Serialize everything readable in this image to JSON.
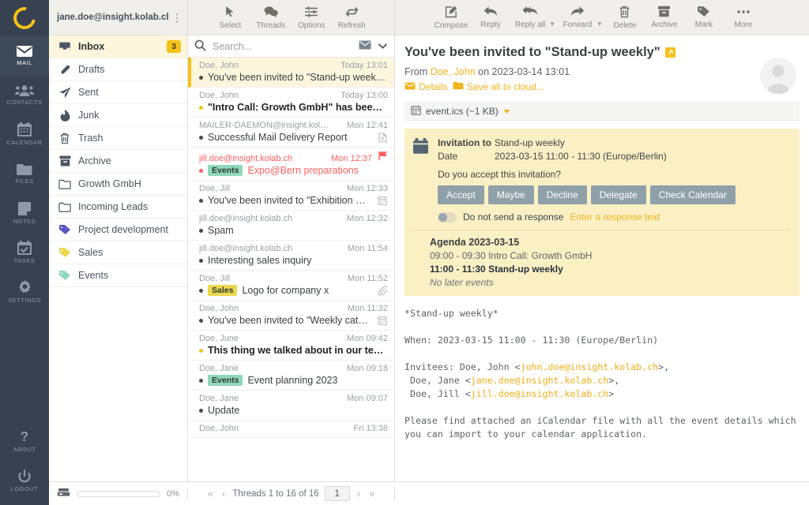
{
  "rail": {
    "logo": "kolab-logo",
    "items": [
      {
        "label": "MAIL",
        "icon": "mail-icon",
        "active": true
      },
      {
        "label": "CONTACTS",
        "icon": "contacts-icon",
        "active": false
      },
      {
        "label": "CALENDAR",
        "icon": "calendar-icon",
        "active": false
      },
      {
        "label": "FILES",
        "icon": "folder-icon",
        "active": false
      },
      {
        "label": "NOTES",
        "icon": "note-icon",
        "active": false
      },
      {
        "label": "TASKS",
        "icon": "tasks-icon",
        "active": false
      },
      {
        "label": "SETTINGS",
        "icon": "gear-icon",
        "active": false
      }
    ],
    "bottom": [
      {
        "label": "ABOUT",
        "icon": "question-icon"
      },
      {
        "label": "LOGOUT",
        "icon": "power-icon"
      }
    ]
  },
  "account": {
    "email": "jane.doe@insight.kolab.ch",
    "menu_icon": "kebab-menu-icon"
  },
  "folders": [
    {
      "label": "Inbox",
      "icon": "inbox-icon",
      "badge": "3",
      "active": true
    },
    {
      "label": "Drafts",
      "icon": "pencil-icon",
      "badge": "",
      "active": false
    },
    {
      "label": "Sent",
      "icon": "paper-plane-icon",
      "badge": "",
      "active": false
    },
    {
      "label": "Junk",
      "icon": "fire-icon",
      "badge": "",
      "active": false
    },
    {
      "label": "Trash",
      "icon": "trash-icon",
      "badge": "",
      "active": false
    },
    {
      "label": "Archive",
      "icon": "archive-icon",
      "badge": "",
      "active": false
    },
    {
      "label": "Growth GmbH",
      "icon": "folder-icon",
      "badge": "",
      "active": false
    },
    {
      "label": "Incoming Leads",
      "icon": "folder-icon",
      "badge": "",
      "active": false
    },
    {
      "label": "Project development",
      "icon": "tag-icon",
      "badge": "",
      "active": false,
      "tag_color": "#5b54c7"
    },
    {
      "label": "Sales",
      "icon": "tag-icon",
      "badge": "",
      "active": false,
      "tag_color": "#ecd84e"
    },
    {
      "label": "Events",
      "icon": "tag-icon",
      "badge": "",
      "active": false,
      "tag_color": "#8fd8bb"
    }
  ],
  "list_toolbar": [
    {
      "label": "Select",
      "icon": "cursor-icon"
    },
    {
      "label": "Threads",
      "icon": "threads-icon"
    },
    {
      "label": "Options",
      "icon": "sliders-icon"
    },
    {
      "label": "Refresh",
      "icon": "refresh-icon"
    }
  ],
  "search": {
    "placeholder": "Search...",
    "icon": "search-icon",
    "scope_icon": "envelope-icon",
    "expand_icon": "chevron-down-icon"
  },
  "messages": [
    {
      "from": "Doe, John",
      "date": "Today 13:01",
      "subject": "You've been invited to \"Stand-up week…",
      "state": "selected",
      "tag": "",
      "icon": ""
    },
    {
      "from": "Doe, John",
      "date": "Today 13:00",
      "subject": "\"Intro Call: Growth GmbH\" has been a…",
      "state": "unread",
      "tag": "",
      "icon": ""
    },
    {
      "from": "MAILER-DAEMON@insight.kol…",
      "date": "Mon 12:41",
      "subject": "Successful Mail Delivery Report",
      "state": "read",
      "tag": "",
      "icon": "document-icon"
    },
    {
      "from": "jill.doe@insight.kolab.ch",
      "date": "Mon 12:37",
      "subject": "Expo@Bern preparations",
      "state": "flagged",
      "tag": "Events",
      "tag_type": "events",
      "icon": "flag-icon"
    },
    {
      "from": "Doe, Jill",
      "date": "Mon 12:33",
      "subject": "You've been invited to \"Exhibition @Be…",
      "state": "read",
      "tag": "",
      "icon": "calendar-icon"
    },
    {
      "from": "jill.doe@insight.kolab.ch",
      "date": "Mon 12:32",
      "subject": "Spam",
      "state": "read",
      "tag": "",
      "icon": ""
    },
    {
      "from": "jill.doe@insight.kolab.ch",
      "date": "Mon 11:54",
      "subject": "Interesting sales inquiry",
      "state": "read",
      "tag": "",
      "icon": ""
    },
    {
      "from": "Doe, Jill",
      "date": "Mon 11:52",
      "subject": "Logo for company x",
      "state": "read",
      "tag": "Sales",
      "tag_type": "sales",
      "icon": "paperclip-icon"
    },
    {
      "from": "Doe, John",
      "date": "Mon 11:32",
      "subject": "You've been invited to \"Weekly catch-…",
      "state": "read",
      "tag": "",
      "icon": "calendar-icon"
    },
    {
      "from": "Doe, June",
      "date": "Mon 09:42",
      "subject": "This thing we talked about in our test…",
      "state": "unread",
      "tag": "",
      "icon": ""
    },
    {
      "from": "Doe, Jane",
      "date": "Mon 09:18",
      "subject": "Event planning 2023",
      "state": "read",
      "tag": "Events",
      "tag_type": "events",
      "icon": ""
    },
    {
      "from": "Doe, Jane",
      "date": "Mon 09:07",
      "subject": "Update",
      "state": "read",
      "tag": "",
      "icon": ""
    },
    {
      "from": "Doe, John",
      "date": "Fri 13:38",
      "subject": "",
      "state": "read",
      "tag": "",
      "icon": ""
    }
  ],
  "preview_toolbar": [
    {
      "label": "Compose",
      "icon": "compose-icon",
      "caret": false
    },
    {
      "label": "Reply",
      "icon": "reply-icon",
      "caret": false
    },
    {
      "label": "Reply all",
      "icon": "reply-all-icon",
      "caret": true
    },
    {
      "label": "Forward",
      "icon": "forward-icon",
      "caret": true
    },
    {
      "label": "Delete",
      "icon": "trash-icon",
      "caret": false
    },
    {
      "label": "Archive",
      "icon": "archive-icon",
      "caret": false
    },
    {
      "label": "Mark",
      "icon": "tag-icon",
      "caret": false
    },
    {
      "label": "More",
      "icon": "ellipsis-icon",
      "caret": false
    }
  ],
  "message": {
    "subject": "You've been invited to \"Stand-up weekly\"",
    "external_icon": "open-external-icon",
    "from_prefix": "From",
    "from_name": "Doe, John",
    "from_suffix": "on 2023-03-14 13:01",
    "details_label": "Details",
    "save_all_label": "Save all to cloud...",
    "attachment": "event.ics (~1 KB)",
    "attachment_icon": "calendar-icon",
    "attachment_caret": "caret-down-icon",
    "avatar": "contact-avatar"
  },
  "itip": {
    "icon": "calendar-icon",
    "invitation_key": "Invitation to",
    "invitation_value": "Stand-up weekly",
    "date_key": "Date",
    "date_value": "2023-03-15 11:00 - 11:30 (Europe/Berlin)",
    "question": "Do you accept this invitation?",
    "buttons": [
      "Accept",
      "Maybe",
      "Decline",
      "Delegate",
      "Check Calendar"
    ],
    "toggle_label": "Do not send a response",
    "response_link": "Enter a response text",
    "agenda_title": "Agenda 2023-03-15",
    "agenda": [
      {
        "time": "09:00 - 09:30",
        "title": "Intro Call: Growth GmbH",
        "current": false
      },
      {
        "time": "11:00 - 11:30",
        "title": "Stand-up weekly",
        "current": true
      }
    ],
    "agenda_none": "No later events"
  },
  "body": {
    "line_title": "*Stand-up weekly*",
    "line_when": "When: 2023-03-15 11:00 - 11:30 (Europe/Berlin)",
    "invitees_label": "Invitees: Doe, John <",
    "invitee1_mail": "john.doe@insight.kolab.ch",
    "invitee2_label": " Doe, Jane <",
    "invitee2_mail": "jane.doe@insight.kolab.ch",
    "invitee3_label": " Doe, Jill <",
    "invitee3_mail": "jill.doe@insight.kolab.ch",
    "footer": "Please find attached an iCalendar file with all the event details which\nyou can import to your calendar application."
  },
  "status": {
    "quota_icon": "disk-icon",
    "quota_percent": "0%",
    "first_icon": "first-page-icon",
    "prev_icon": "prev-page-icon",
    "counter": "Threads 1 to 16 of 16",
    "page_value": "1",
    "next_icon": "next-page-icon",
    "last_icon": "last-page-icon"
  },
  "colors": {
    "accent": "#f5c219",
    "rail_bg": "#37414f",
    "toolbar_bg": "#f0efeb",
    "selected_row": "#fdf6dd",
    "itip_bg": "#fbefc4",
    "flag_red": "#fc5f5f",
    "button_grey": "#90a0a8"
  }
}
